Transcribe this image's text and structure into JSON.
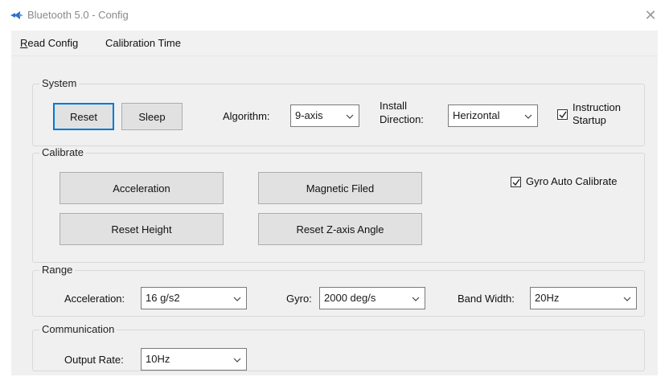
{
  "window": {
    "title": "Bluetooth 5.0 - Config",
    "close_glyph": "✕"
  },
  "menu": {
    "read_config_accel": "R",
    "read_config_rest": "ead Config",
    "calibration_time": "Calibration Time"
  },
  "system": {
    "label": "System",
    "reset": "Reset",
    "sleep": "Sleep",
    "algorithm_label": "Algorithm:",
    "algorithm_value": "9-axis",
    "install_label_line1": "Install",
    "install_label_line2": "Direction:",
    "install_value": "Herizontal",
    "instruction_line1": "Instruction",
    "instruction_line2": "Startup",
    "instruction_checked": true
  },
  "calibrate": {
    "label": "Calibrate",
    "acceleration": "Acceleration",
    "magnetic": "Magnetic Filed",
    "reset_height": "Reset Height",
    "reset_z": "Reset Z-axis Angle",
    "gyro_auto": "Gyro Auto Calibrate",
    "gyro_auto_checked": true
  },
  "range": {
    "label": "Range",
    "acceleration_label": "Acceleration:",
    "acceleration_value": "16 g/s2",
    "gyro_label": "Gyro:",
    "gyro_value": "2000 deg/s",
    "bandwidth_label": "Band Width:",
    "bandwidth_value": "20Hz"
  },
  "communication": {
    "label": "Communication",
    "output_rate_label": "Output Rate:",
    "output_rate_value": "10Hz"
  },
  "colors": {
    "focus_border": "#0078d7",
    "button_bg": "#e1e1e1",
    "client_bg": "#f0f0f0"
  }
}
